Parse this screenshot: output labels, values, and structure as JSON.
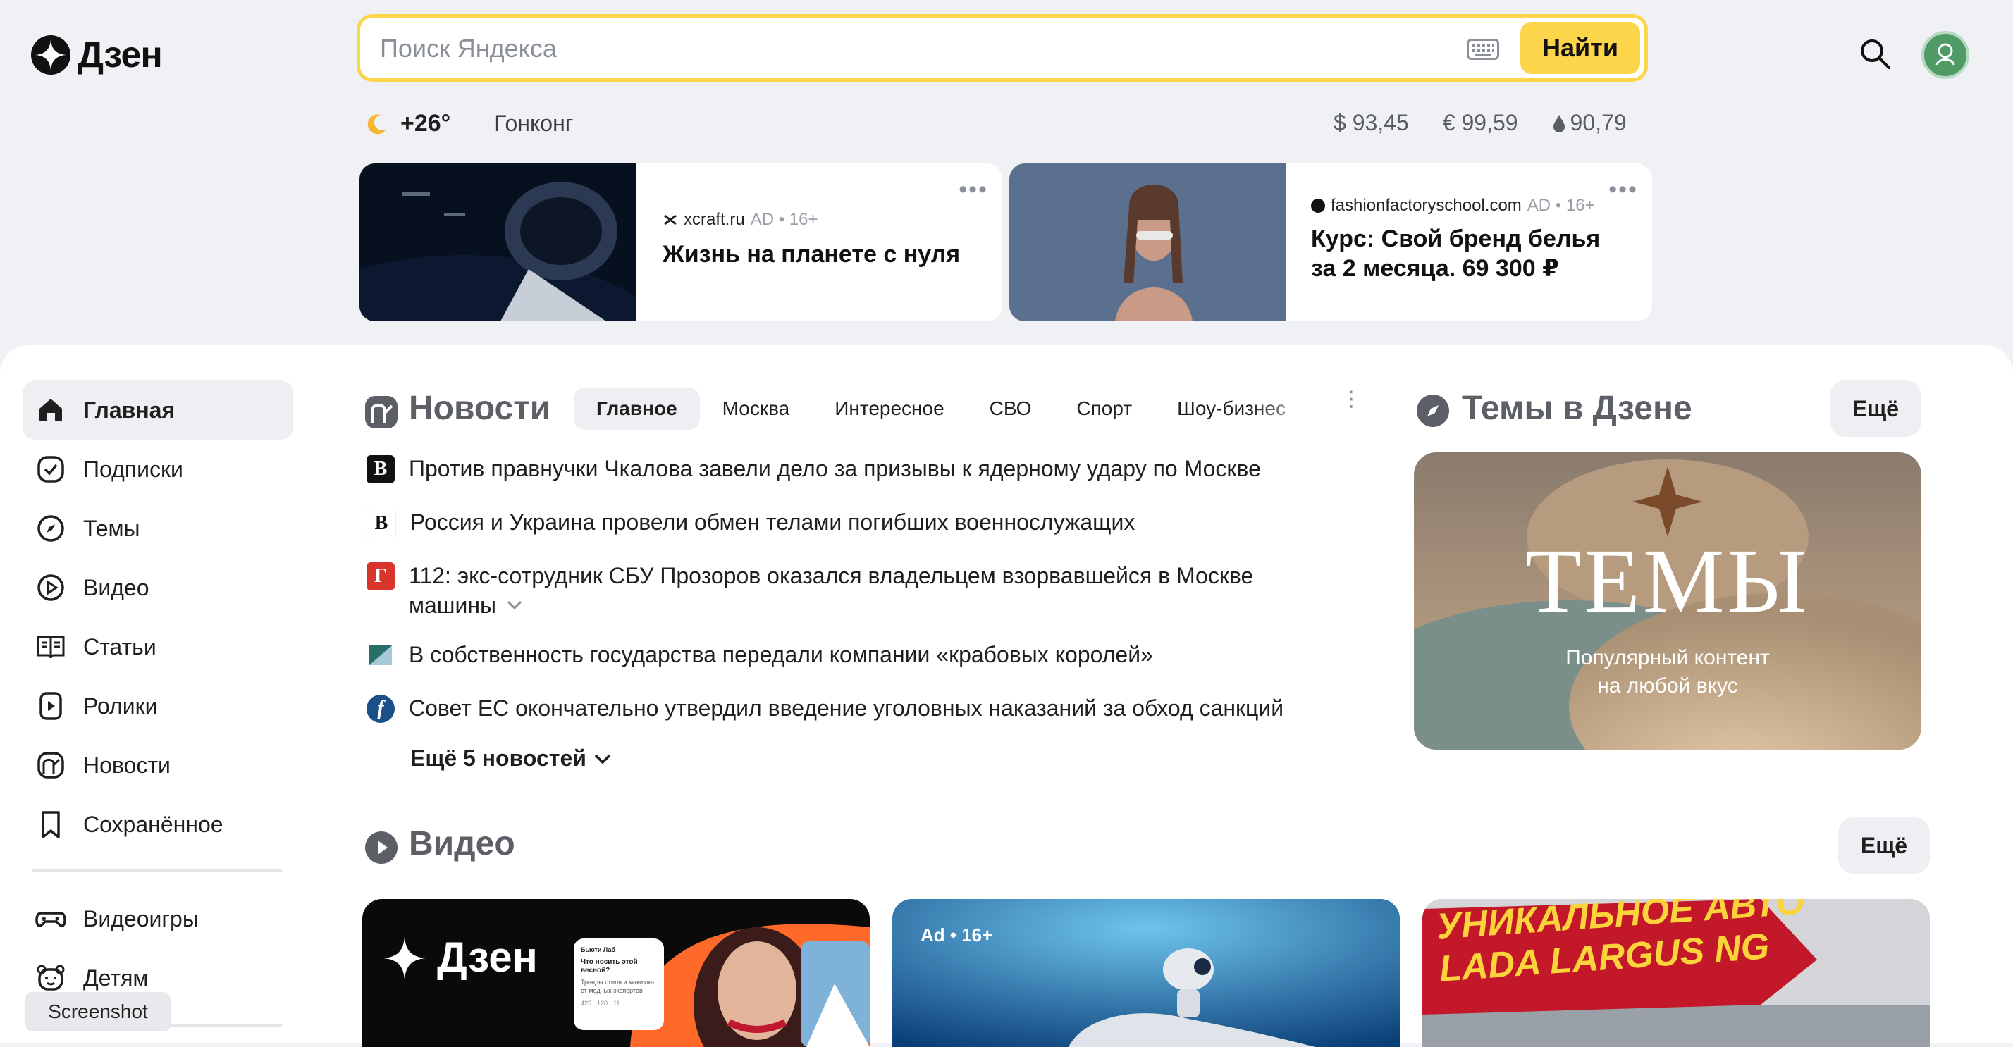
{
  "header": {
    "logo_text": "Дзен",
    "search_placeholder": "Поиск Яндекса",
    "find_button": "Найти"
  },
  "info": {
    "temperature": "+26°",
    "city": "Гонконг",
    "rates": [
      "$ 93,45",
      "€ 99,59",
      "90,79"
    ]
  },
  "ads": [
    {
      "source": "xcraft.ru",
      "meta": "AD • 16+",
      "title": "Жизнь на планете с нуля"
    },
    {
      "source": "fashionfactoryschool.com",
      "meta": "AD • 16+",
      "title_lines": [
        "Курс: Свой бренд белья",
        "за 2 месяца. 69 300 ₽"
      ]
    }
  ],
  "sidebar": {
    "items": [
      {
        "label": "Главная",
        "icon": "home-icon",
        "active": true
      },
      {
        "label": "Подписки",
        "icon": "subscriptions-icon"
      },
      {
        "label": "Темы",
        "icon": "compass-icon"
      },
      {
        "label": "Видео",
        "icon": "video-icon"
      },
      {
        "label": "Статьи",
        "icon": "articles-icon"
      },
      {
        "label": "Ролики",
        "icon": "clips-icon"
      },
      {
        "label": "Новости",
        "icon": "news-icon"
      },
      {
        "label": "Сохранённое",
        "icon": "bookmark-icon"
      }
    ],
    "items2": [
      {
        "label": "Видеоигры",
        "icon": "gamepad-icon"
      },
      {
        "label": "Детям",
        "icon": "kids-icon"
      }
    ],
    "tooltip": "Screenshot"
  },
  "news": {
    "title": "Новости",
    "tabs": [
      "Главное",
      "Москва",
      "Интересное",
      "СВО",
      "Спорт",
      "Шоу-бизнес"
    ],
    "items": [
      {
        "text": "Против правнучки Чкалова завели дело за призывы к ядерному удару по Москве"
      },
      {
        "text": "Россия и Украина провели обмен телами погибших военнослужащих"
      },
      {
        "text_lines": [
          "112: экс-сотрудник СБУ Прозоров оказался владельцем взорвавшейся в Москве",
          "машины"
        ]
      },
      {
        "text": "В собственность государства передали компании «крабовых королей»"
      },
      {
        "text": "Совет ЕС окончательно утвердил введение уголовных наказаний за обход санкций"
      }
    ],
    "more": "Ещё 5 новостей"
  },
  "themes": {
    "title": "Темы в Дзене",
    "more": "Ещё",
    "card_title": "ТЕМЫ",
    "card_sub_lines": [
      "Популярный контент",
      "на любой вкус"
    ]
  },
  "video": {
    "title": "Видео",
    "more": "Ещё",
    "card1_logo": "Дзен",
    "card1_bubble": {
      "name": "Бьюти Лаб",
      "text": "Что носить этой весной?",
      "sub": "Тренды стиля и макияжа от модных экспертов",
      "stats": [
        "425",
        "120",
        "11"
      ]
    },
    "card2_badge": "Ad • 16+",
    "card3_lines": [
      "УНИКАЛЬНОЕ АВТО",
      "LADA LARGUS NG"
    ]
  },
  "colors": {
    "accent": "#fdd54a",
    "page_bg": "#eff1f5"
  }
}
